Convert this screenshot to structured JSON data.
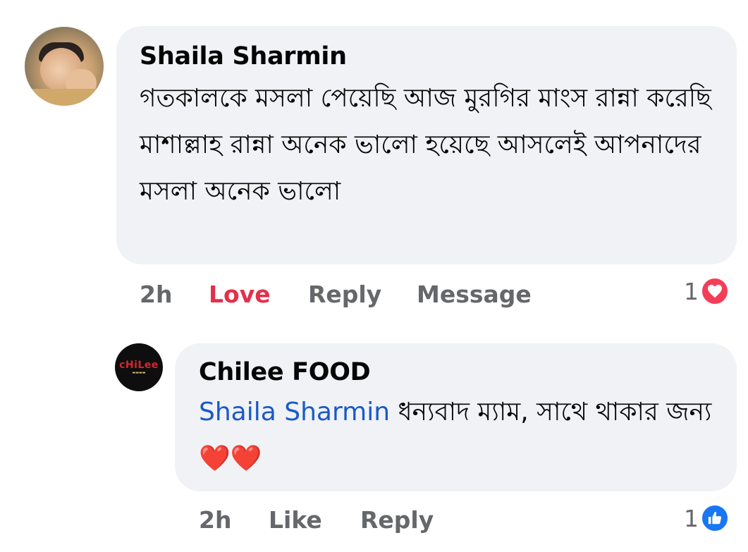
{
  "comment": {
    "author": "Shaila Sharmin",
    "text": "গতকালকে মসলা পেয়েছি আজ মুরগির মাংস রান্না করেছি মাশাল্লাহ রান্না অনেক ভালো হয়েছে আসলেই আপনাদের মসলা অনেক ভালো",
    "actions": {
      "time": "2h",
      "reaction": "Love",
      "reply": "Reply",
      "message": "Message"
    },
    "reaction_count": "1",
    "reaction_icon": "heart-icon",
    "reaction_color": "#f33e58"
  },
  "reply": {
    "author": "Chilee FOOD",
    "avatar_logo": "cHiLee",
    "mention": "Shaila Sharmin",
    "text": "ধন্যবাদ ম্যাম,  সাথে থাকার জন্য❤️❤️",
    "actions": {
      "time": "2h",
      "like": "Like",
      "reply": "Reply"
    },
    "reaction_count": "1",
    "reaction_icon": "like-icon",
    "reaction_color": "#1877f2"
  },
  "colors": {
    "bubble": "#f0f2f5",
    "action_text": "#65676b",
    "love": "#e4304b",
    "mention": "#1a59c9"
  }
}
